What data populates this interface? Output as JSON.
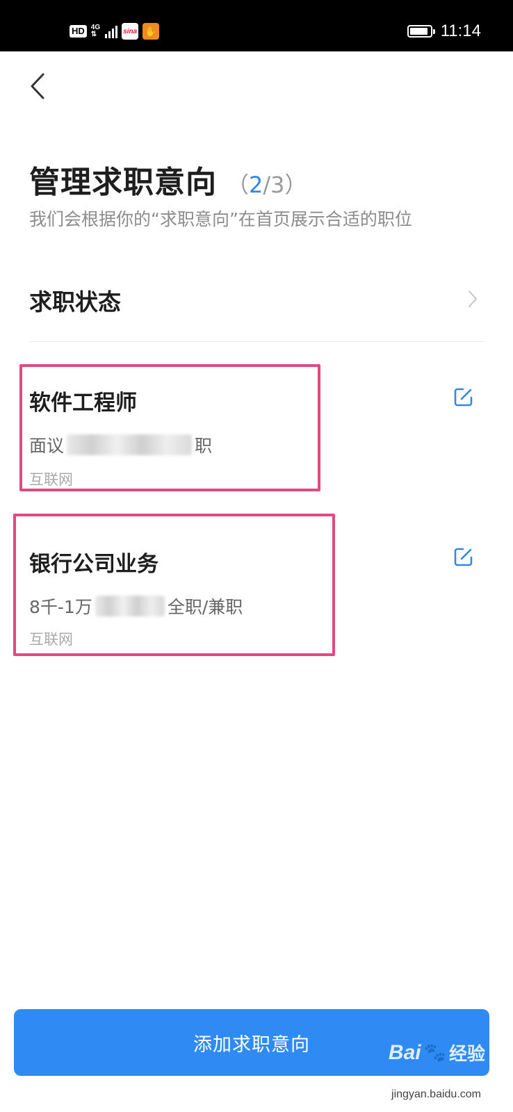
{
  "status_bar": {
    "hd_badge": "HD",
    "network_top": "4G",
    "network_bottom": "⇅",
    "sina_badge": "sina",
    "hand_badge": "✋",
    "battery_level": 0.9,
    "time": "11:14"
  },
  "header": {
    "back_icon": "chevron-left-icon",
    "title": "管理求职意向",
    "count_open": "（",
    "count_current": "2",
    "count_rest": "/3）",
    "subtitle": "我们会根据你的“求职意向”在首页展示合适的职位"
  },
  "job_status": {
    "label": "求职状态",
    "chevron_icon": "chevron-right-icon"
  },
  "intents": [
    {
      "title": "软件工程师",
      "salary": "面议",
      "meta_tail": "职",
      "industry": "互联网",
      "edit_icon": "edit-icon"
    },
    {
      "title": "银行公司业务",
      "salary": "8千-1万",
      "meta_tail": "全职/兼职",
      "industry": "互联网",
      "edit_icon": "edit-icon"
    }
  ],
  "actions": {
    "add_label": "添加求职意向"
  },
  "watermark": {
    "brand": "Bai",
    "paw": "🐾",
    "brand_text": "经验",
    "url": "jingyan.baidu.com"
  },
  "colors": {
    "accent": "#2f8bf3",
    "highlight": "#e04a7f",
    "count_current": "#2f87e6"
  }
}
